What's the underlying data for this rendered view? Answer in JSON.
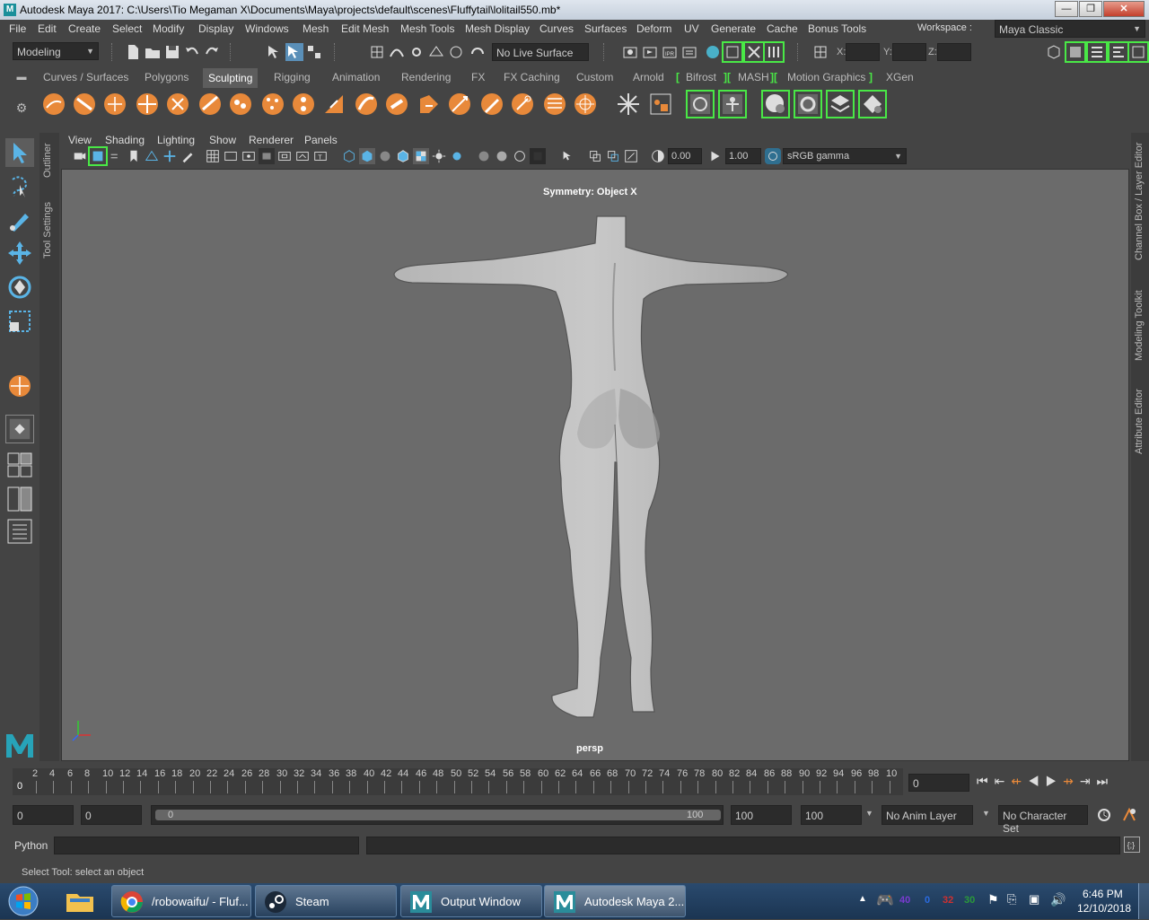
{
  "window": {
    "title": "Autodesk Maya 2017: C:\\Users\\Tio Megaman X\\Documents\\Maya\\projects\\default\\scenes\\Fluffytail\\lolitail550.mb*",
    "minimize": "—",
    "maximize": "❐",
    "close": "✕"
  },
  "menubar": {
    "items": [
      "File",
      "Edit",
      "Create",
      "Select",
      "Modify",
      "Display",
      "Windows",
      "Mesh",
      "Edit Mesh",
      "Mesh Tools",
      "Mesh Display",
      "Curves",
      "Surfaces",
      "Deform",
      "UV",
      "Generate",
      "Cache",
      "Bonus Tools"
    ],
    "workspace_label": "Workspace :",
    "workspace_value": "Maya Classic"
  },
  "statusline": {
    "menuset": "Modeling",
    "live_surface": "No Live Surface",
    "x_label": "X:",
    "y_label": "Y:",
    "z_label": "Z:"
  },
  "shelf": {
    "tabs": [
      "Curves / Surfaces",
      "Polygons",
      "Sculpting",
      "Rigging",
      "Animation",
      "Rendering",
      "FX",
      "FX Caching",
      "Custom",
      "Arnold",
      "Bifrost",
      "MASH",
      "Motion Graphics",
      "XGen"
    ],
    "active_tab": "Sculpting",
    "accent_color": "#e8893a",
    "bracket_color": "#49e846"
  },
  "side_tabs": {
    "left": [
      "Outliner",
      "Tool Settings"
    ],
    "right": [
      "Channel Box / Layer Editor",
      "Modeling Toolkit",
      "Attribute Editor"
    ]
  },
  "viewport": {
    "panel_menu": [
      "View",
      "Shading",
      "Lighting",
      "Show",
      "Renderer",
      "Panels"
    ],
    "exposure": "0.00",
    "gamma": "1.00",
    "color_space": "sRGB gamma",
    "symmetry": "Symmetry: Object X",
    "camera": "persp",
    "background": "#6b6b6b"
  },
  "timeline": {
    "ticks": [
      "2",
      "4",
      "6",
      "8",
      "10",
      "12",
      "14",
      "16",
      "18",
      "20",
      "22",
      "24",
      "26",
      "28",
      "30",
      "32",
      "34",
      "36",
      "38",
      "40",
      "42",
      "44",
      "46",
      "48",
      "50",
      "52",
      "54",
      "56",
      "58",
      "60",
      "62",
      "64",
      "66",
      "68",
      "70",
      "72",
      "74",
      "76",
      "78",
      "80",
      "82",
      "84",
      "86",
      "88",
      "90",
      "92",
      "94",
      "96",
      "98",
      "10"
    ],
    "current_frame_marker": "0",
    "current_frame": "0"
  },
  "range": {
    "start": "0",
    "playback_start": "0",
    "slider_start": "0",
    "slider_end": "100",
    "playback_end": "100",
    "end": "100",
    "anim_layer": "No Anim Layer",
    "character_set": "No Character Set"
  },
  "commandline": {
    "language": "Python"
  },
  "helpline": {
    "text": "Select Tool: select an object"
  },
  "taskbar": {
    "tasks": [
      "/robowaifu/ - Fluf...",
      "Steam",
      "Output Window",
      "Autodesk Maya 2..."
    ],
    "time": "6:46 PM",
    "date": "12/10/2018",
    "tray_numbers": [
      "40",
      "0",
      "32",
      "30"
    ]
  }
}
